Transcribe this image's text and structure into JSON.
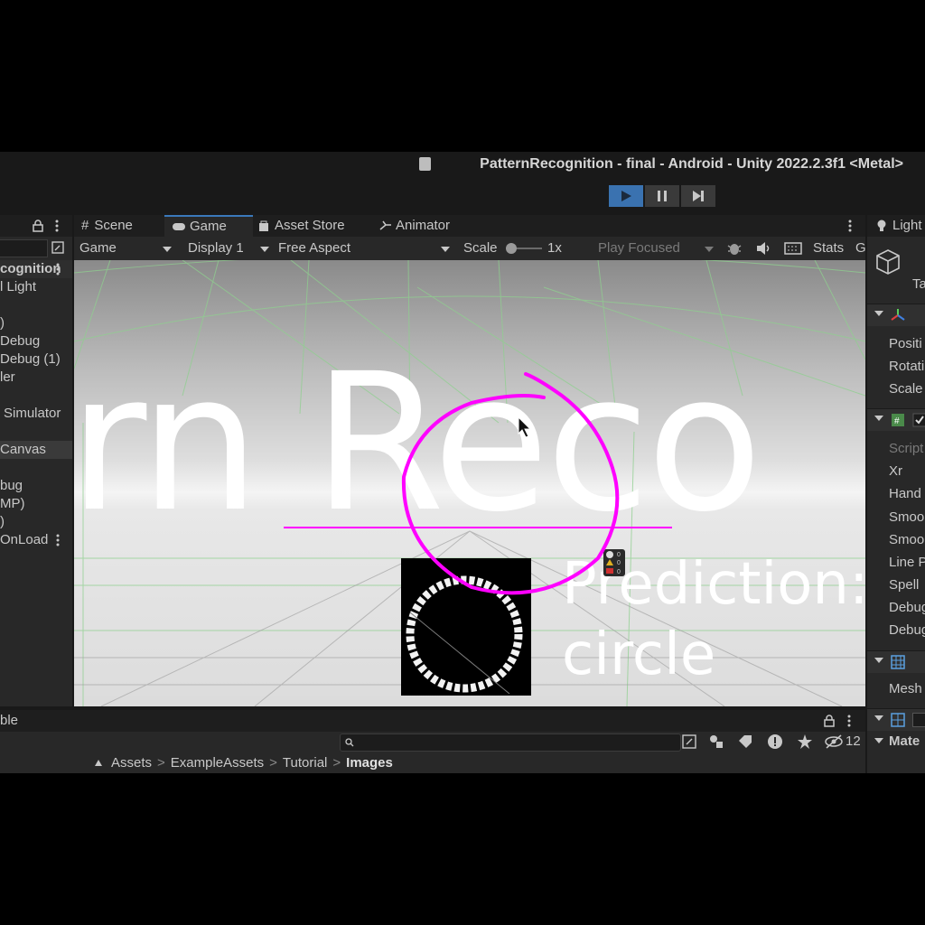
{
  "window": {
    "title": "PatternRecognition - final - Android - Unity 2022.2.3f1 <Metal>"
  },
  "hierarchy": {
    "items": [
      {
        "label": "cognition"
      },
      {
        "label": "l Light"
      },
      {
        "label": ")"
      },
      {
        "label": "Debug"
      },
      {
        "label": "Debug (1)"
      },
      {
        "label": "ler"
      },
      {
        "label": "Simulator"
      },
      {
        "label": "Canvas"
      },
      {
        "label": "bug"
      },
      {
        "label": "MP)"
      },
      {
        "label": ")"
      },
      {
        "label": "OnLoad"
      }
    ]
  },
  "center_tabs": [
    {
      "label": "Scene",
      "icon": "hash-icon"
    },
    {
      "label": "Game",
      "icon": "gamepad-icon"
    },
    {
      "label": "Asset Store",
      "icon": "bag-icon"
    },
    {
      "label": "Animator",
      "icon": "animator-icon"
    }
  ],
  "game_toolbar": {
    "mode": "Game",
    "display": "Display 1",
    "aspect": "Free Aspect",
    "scale_label": "Scale",
    "scale_value": "1x",
    "play_focused": "Play Focused",
    "stats": "Stats",
    "gizmos": "G"
  },
  "game_view": {
    "big_text": "rn Reco",
    "prediction_label": "Prediction:",
    "prediction_value": "circle",
    "console_counts": [
      "0",
      "0",
      "0"
    ]
  },
  "inspector": {
    "tab": "Light",
    "tag_label": "Ta",
    "transform_fields": [
      "Positi",
      "Rotati",
      "Scale"
    ],
    "script_fields": [
      "Script",
      "Xr",
      "Hand",
      "Smoo",
      "Smoo",
      "Line P",
      "Spell",
      "Debug",
      "Debug"
    ],
    "mesh_label": "Mesh",
    "material_label": "Mate"
  },
  "bottom": {
    "tab_label": "ble",
    "hidden_count": "12",
    "breadcrumbs": [
      "Assets",
      "ExampleAssets",
      "Tutorial",
      "Images"
    ]
  },
  "colors": {
    "accent": "#3a79bb",
    "stroke": "#ff00ff"
  }
}
